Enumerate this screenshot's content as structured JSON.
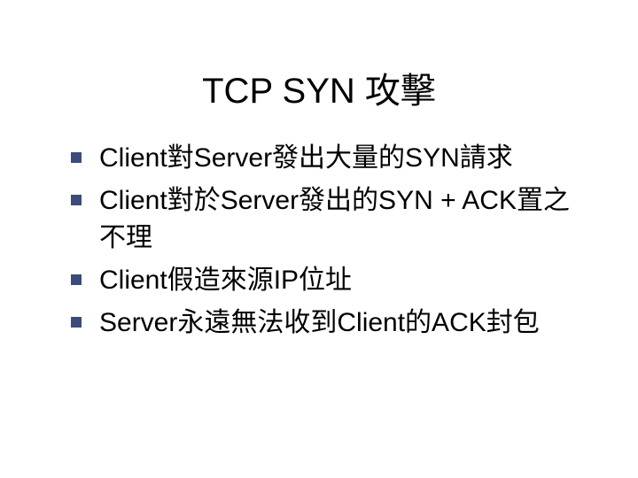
{
  "slide": {
    "title": "TCP SYN 攻擊",
    "bullets": [
      "Client對Server發出大量的SYN請求",
      "Client對於Server發出的SYN + ACK置之不理",
      "Client假造來源IP位址",
      "Server永遠無法收到Client的ACK封包"
    ]
  }
}
